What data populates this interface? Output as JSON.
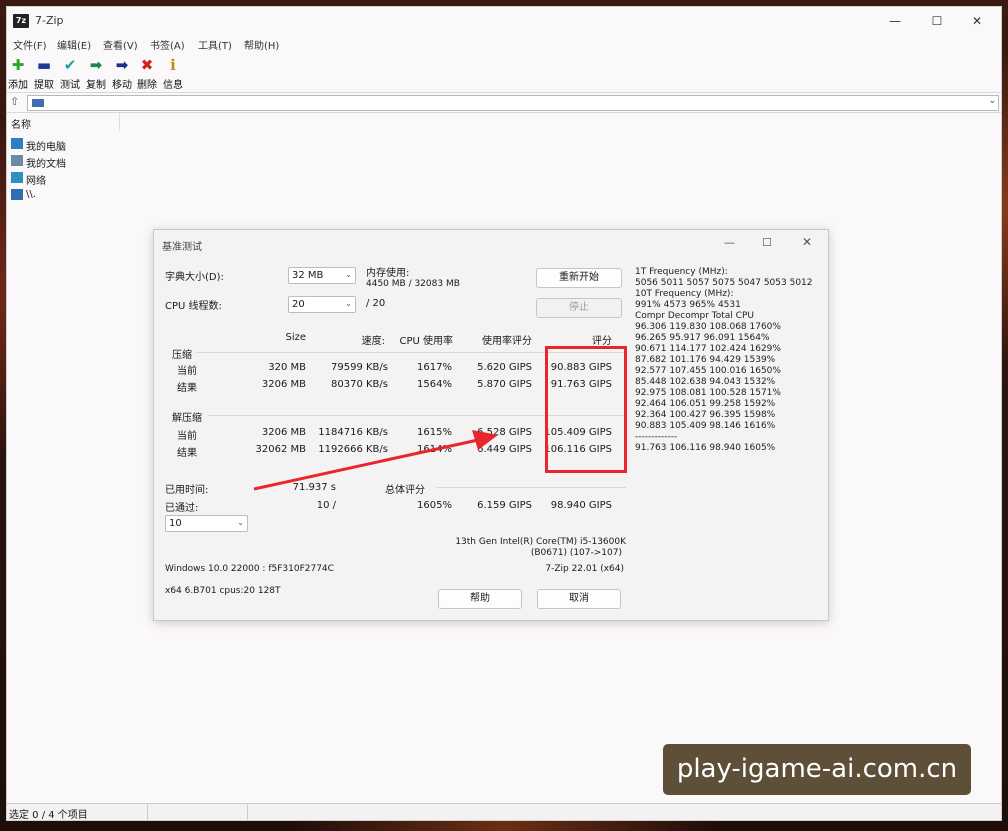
{
  "app": {
    "icon_text": "7z",
    "title": "7-Zip",
    "min": "—",
    "max": "☐",
    "close": "✕"
  },
  "menu": [
    "文件(F)",
    "编辑(E)",
    "查看(V)",
    "书签(A)",
    "工具(T)",
    "帮助(H)"
  ],
  "toolbar": [
    {
      "label": "添加",
      "icon": "plus-icon",
      "glyph": "✚",
      "color": "#2aa52a"
    },
    {
      "label": "提取",
      "icon": "minus-icon",
      "glyph": "▬",
      "color": "#1b3b9a"
    },
    {
      "label": "测试",
      "icon": "check-icon",
      "glyph": "✔",
      "color": "#1aa0a0"
    },
    {
      "label": "复制",
      "icon": "copy-arrow-icon",
      "glyph": "➡",
      "color": "#1a8a4a"
    },
    {
      "label": "移动",
      "icon": "move-arrow-icon",
      "glyph": "➡",
      "color": "#1b2f8a"
    },
    {
      "label": "删除",
      "icon": "delete-x-icon",
      "glyph": "✖",
      "color": "#d21f1f"
    },
    {
      "label": "信息",
      "icon": "info-icon",
      "glyph": "ℹ",
      "color": "#c08a10"
    }
  ],
  "address": {
    "up": "⇧",
    "dropdown": "⌄"
  },
  "filelist": {
    "column": "名称",
    "items": [
      {
        "label": "我的电脑",
        "icon": "computer-icon",
        "color": "#2f7fc0"
      },
      {
        "label": "我的文档",
        "icon": "documents-icon",
        "color": "#6a8aa8"
      },
      {
        "label": "网络",
        "icon": "network-icon",
        "color": "#2f8fc0"
      },
      {
        "label": "\\\\.",
        "icon": "drive-icon",
        "color": "#2f6fb0"
      }
    ]
  },
  "status": "选定 0 / 4 个项目",
  "dialog": {
    "title": "基准测试",
    "dict_label": "字典大小(D):",
    "dict_value": "32 MB",
    "threads_label": "CPU 线程数:",
    "threads_value": "20",
    "threads_of": "/ 20",
    "mem_label": "内存使用:",
    "mem_value": "4450 MB / 32083 MB",
    "restart_button": "重新开始",
    "stop_button": "停止",
    "headers": {
      "size": "Size",
      "speed": "速度:",
      "cpu": "CPU 使用率",
      "usage_score": "使用率评分",
      "score": "评分"
    },
    "compress_label": "压缩",
    "compress_rows": [
      {
        "label": "当前",
        "size": "320 MB",
        "speed": "79599 KB/s",
        "cpu": "1617%",
        "usage": "5.620 GIPS",
        "score": "90.883 GIPS"
      },
      {
        "label": "结果",
        "size": "3206 MB",
        "speed": "80370 KB/s",
        "cpu": "1564%",
        "usage": "5.870 GIPS",
        "score": "91.763 GIPS"
      }
    ],
    "decompress_label": "解压缩",
    "decompress_rows": [
      {
        "label": "当前",
        "size": "3206 MB",
        "speed": "1184716 KB/s",
        "cpu": "1615%",
        "usage": "6.528 GIPS",
        "score": "105.409 GIPS"
      },
      {
        "label": "结果",
        "size": "32062 MB",
        "speed": "1192666 KB/s",
        "cpu": "1614%",
        "usage": "6.449 GIPS",
        "score": "106.116 GIPS"
      }
    ],
    "elapsed_label": "已用时间:",
    "elapsed_value": "71.937 s",
    "passed_label": "已通过:",
    "passed_value": "10 /",
    "passes_select": "10",
    "total_label": "总体评分",
    "total_cpu": "1605%",
    "total_usage": "6.159 GIPS",
    "total_score": "98.940 GIPS",
    "cpu_name": "13th Gen Intel(R) Core(TM) i5-13600K",
    "cpu_id": "(B0671) (107->107)",
    "os": "Windows 10.0 22000 : f5F310F2774C",
    "version": "7-Zip 22.01 (x64)",
    "arch": "x64 6.B701 cpus:20 128T",
    "help_button": "帮助",
    "cancel_button": "取消",
    "freq_lines": [
      "1T Frequency (MHz):",
      " 5056 5011 5057 5075 5047 5053 5012",
      "10T Frequency (MHz):",
      " 991% 4573 965% 4531",
      "Compr Decompr Total  CPU",
      "96.306 119.830 108.068 1760%",
      "96.265 95.917 96.091 1564%",
      "90.671 114.177 102.424 1629%",
      "87.682 101.176 94.429 1539%",
      "92.577 107.455 100.016 1650%",
      "85.448 102.638 94.043 1532%",
      "92.975 108.081 100.528 1571%",
      "92.464 106.051 99.258 1592%",
      "92.364 100.427 96.395 1598%",
      "90.883 105.409 98.146 1616%",
      "-------------",
      "91.763 106.116 98.940 1605%"
    ]
  },
  "watermark": "play-igame-ai.com.cn"
}
